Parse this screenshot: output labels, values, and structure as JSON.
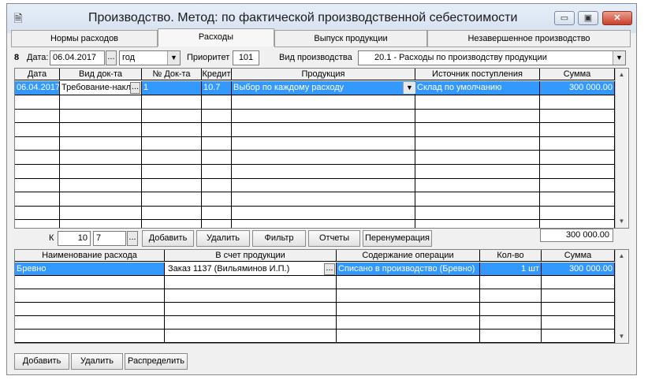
{
  "window": {
    "title": "Производство. Метод: по фактической производственной себестоимости",
    "icon": "document-icon",
    "min": "▭",
    "max": "▣",
    "close": "✕"
  },
  "tabs": [
    {
      "label": "Нормы расходов"
    },
    {
      "label": "Расходы"
    },
    {
      "label": "Выпуск продукции"
    },
    {
      "label": "Незавершенное производство"
    }
  ],
  "toolbar": {
    "num": "8",
    "date_label": "Дата:",
    "date_value": "06.04.2017",
    "dots": "...",
    "period_value": "год",
    "priority_label": "Приоритет",
    "priority_value": "101",
    "prod_type_label": "Вид производства",
    "prod_type_value": "20.1  - Расходы по производству продукции"
  },
  "grid1": {
    "headers": [
      "Дата",
      "Вид док-та",
      "№ Док-та",
      "Кредит",
      "Продукция",
      "Источник поступления",
      "Сумма"
    ],
    "row": [
      "06.04.2017",
      "Требование-накл",
      "1",
      "10.7",
      "Выбор по каждому расходу",
      "Склад по умолчанию",
      "300 000.00"
    ],
    "total": "300 000.00"
  },
  "mid": {
    "k_label": "К",
    "k_value1": "10",
    "k_value2": "7",
    "dots": "...",
    "buttons": [
      "Добавить",
      "Удалить",
      "Фильтр",
      "Отчеты",
      "Перенумерация"
    ]
  },
  "grid2": {
    "headers": [
      "Наименование расхода",
      "В счет продукции",
      "Содержание операции",
      "Кол-во",
      "Сумма"
    ],
    "row": [
      "Бревно",
      "Заказ 1137 (Вильяминов И.П.)",
      "Списано в производство (Бревно)",
      "1 шт",
      "300 000.00"
    ],
    "dots": "..."
  },
  "bottom": {
    "buttons": [
      "Добавить",
      "Удалить",
      "Распределить"
    ]
  },
  "colors": {
    "selection": "#3399ff",
    "window_bg": "#f0f0f0"
  }
}
